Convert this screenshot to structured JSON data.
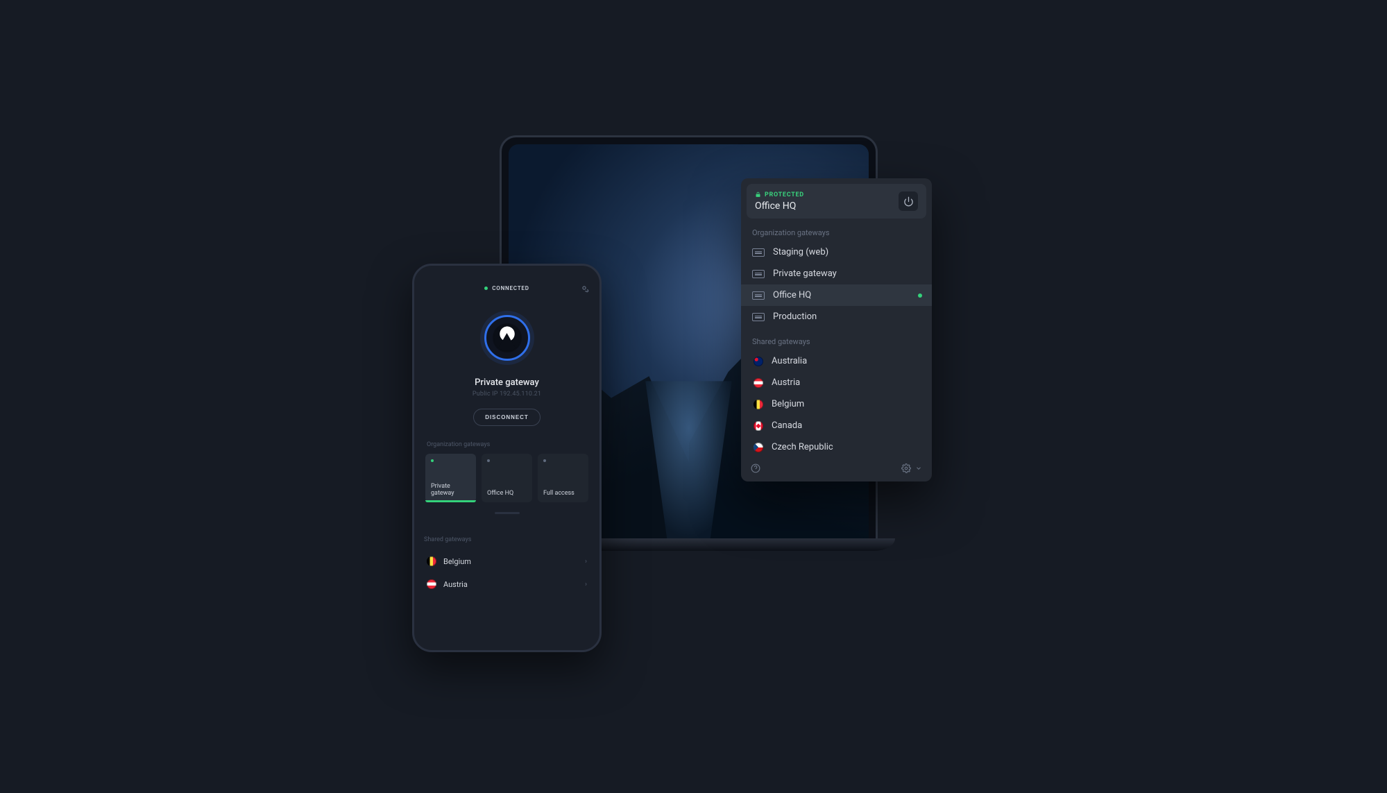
{
  "colors": {
    "accent": "#34d27b",
    "ring": "#2f6fea"
  },
  "phone": {
    "status_label": "CONNECTED",
    "connection_name": "Private gateway",
    "ip_label": "Public IP",
    "ip_value": "192.45.110.21",
    "disconnect_label": "DISCONNECT",
    "org_section_label": "Organization gateways",
    "shared_section_label": "Shared gateways",
    "cards": [
      {
        "label": "Private gateway",
        "active": true
      },
      {
        "label": "Office HQ",
        "active": false
      },
      {
        "label": "Full access",
        "active": false
      }
    ],
    "shared_countries": [
      {
        "label": "Belgium",
        "flag": "be"
      },
      {
        "label": "Austria",
        "flag": "at"
      }
    ]
  },
  "panel": {
    "protected_label": "PROTECTED",
    "connection_name": "Office HQ",
    "org_section_label": "Organization gateways",
    "shared_section_label": "Shared gateways",
    "org_gateways": [
      {
        "label": "Staging (web)",
        "selected": false
      },
      {
        "label": "Private gateway",
        "selected": false
      },
      {
        "label": "Office HQ",
        "selected": true
      },
      {
        "label": "Production",
        "selected": false
      }
    ],
    "shared_gateways": [
      {
        "label": "Australia",
        "flag": "au"
      },
      {
        "label": "Austria",
        "flag": "at"
      },
      {
        "label": "Belgium",
        "flag": "be"
      },
      {
        "label": "Canada",
        "flag": "ca"
      },
      {
        "label": "Czech Republic",
        "flag": "cz"
      }
    ]
  }
}
